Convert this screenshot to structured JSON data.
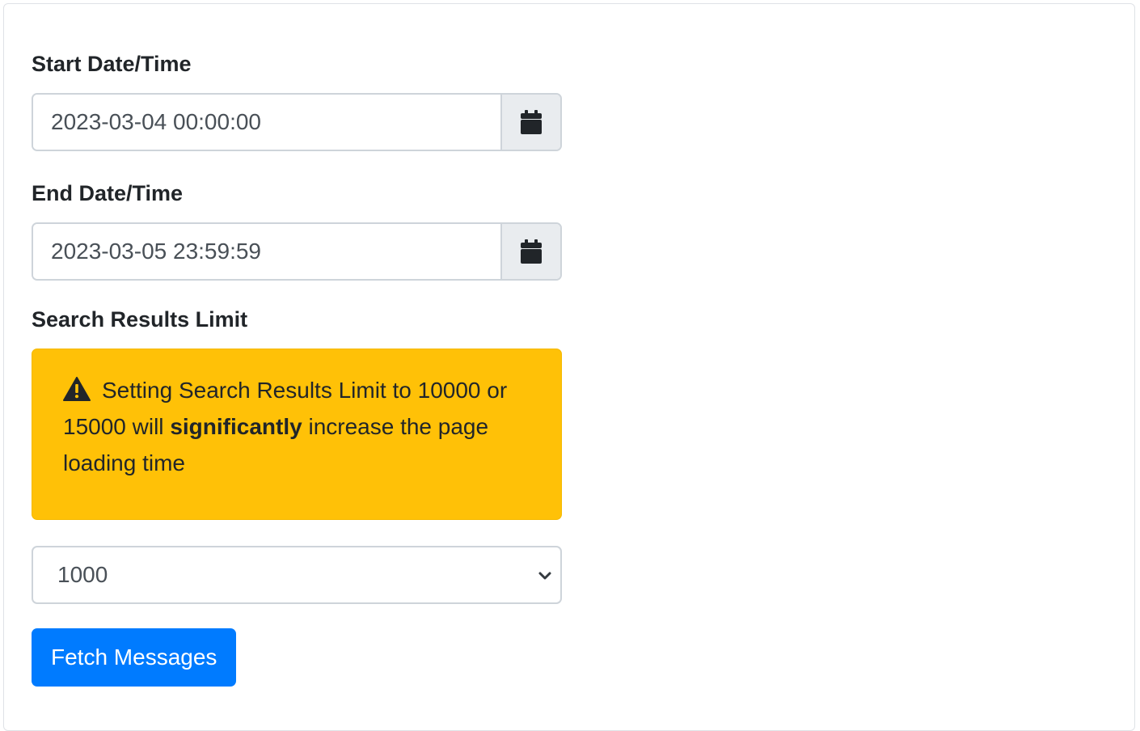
{
  "form": {
    "start": {
      "label": "Start Date/Time",
      "value": "2023-03-04 00:00:00",
      "icon": "calendar-icon"
    },
    "end": {
      "label": "End Date/Time",
      "value": "2023-03-05 23:59:59",
      "icon": "calendar-icon"
    },
    "limit": {
      "label": "Search Results Limit",
      "warning": {
        "icon": "warning-icon",
        "text_before": "Setting Search Results Limit to 10000 or 15000 will ",
        "text_bold": "significantly",
        "text_after": " increase the page loading time"
      },
      "selected": "1000",
      "chevron_icon": "chevron-down-icon"
    },
    "submit_label": "Fetch Messages"
  },
  "colors": {
    "warning_bg": "#ffc107",
    "primary": "#007bff",
    "addon_bg": "#e9ecef",
    "border": "#ced4da"
  }
}
